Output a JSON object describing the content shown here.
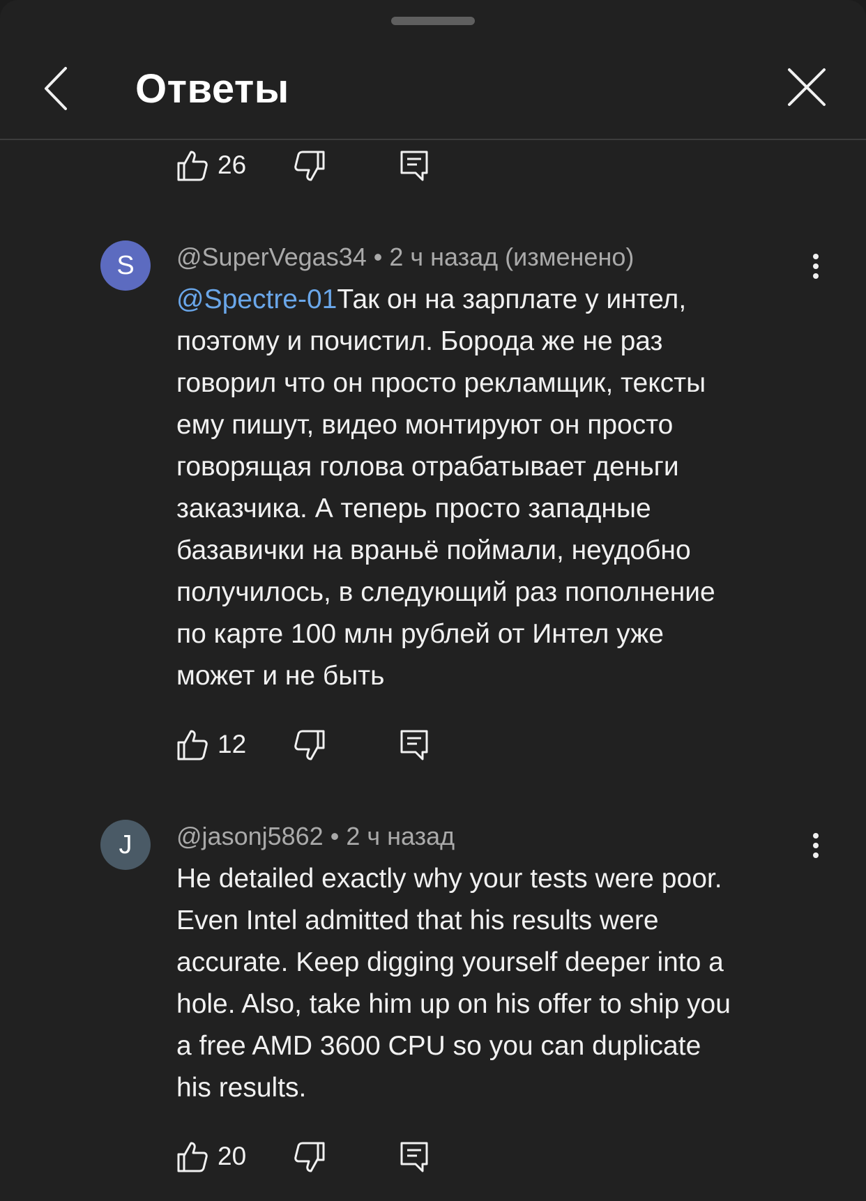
{
  "header": {
    "title": "Ответы"
  },
  "top_actions": {
    "likes": "26"
  },
  "comments": [
    {
      "avatar_letter": "S",
      "avatar_color": "#5c6bc0",
      "author": "@SuperVegas34",
      "time": "2 ч назад (изменено)",
      "mention": "@Spectre-01",
      "lines": [
        "Так он на зарплате у интел,",
        "поэтому и почистил. Борода же не раз",
        "говорил что он просто рекламщик, тексты",
        "ему пишут, видео монтируют он просто",
        "говорящая голова отрабатывает деньги",
        "заказчика.  А теперь просто западные",
        "базавички на враньё поймали, неудобно",
        "получилось, в следующий раз пополнение",
        "по карте 100 млн рублей от Интел уже",
        "может и не быть"
      ],
      "likes": "12"
    },
    {
      "avatar_letter": "J",
      "avatar_color": "#4a5a66",
      "author": "@jasonj5862",
      "time": "2 ч назад",
      "lines": [
        "He detailed exactly why your tests were poor.",
        "Even Intel admitted that his results were",
        "accurate.  Keep digging yourself deeper into a",
        "hole.  Also, take him up on his offer to ship you",
        "a free AMD 3600 CPU so you can duplicate",
        "his results."
      ],
      "likes": "20"
    }
  ]
}
